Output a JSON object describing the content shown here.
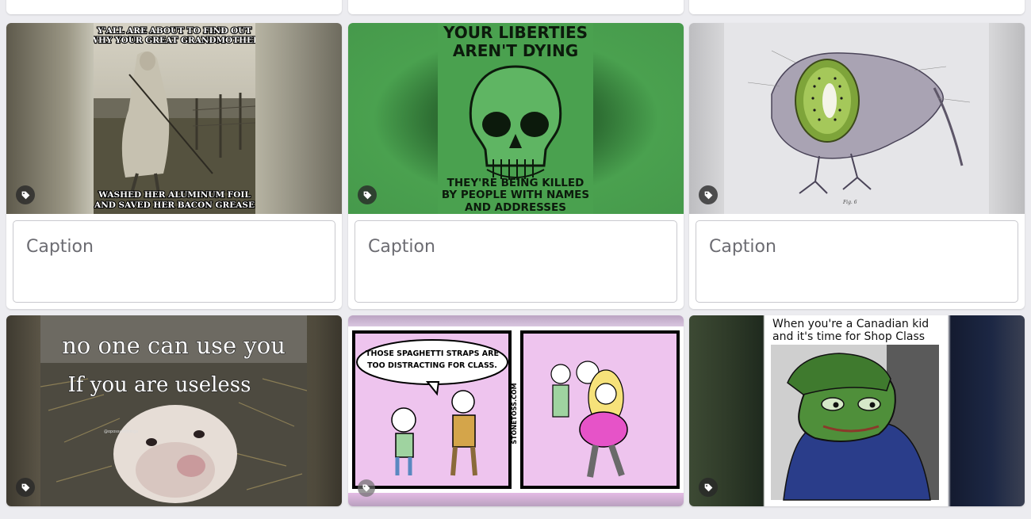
{
  "caption_placeholder": "Caption",
  "cards": [
    {
      "id": "grandmother",
      "top_text_1": "Y'ALL ARE ABOUT TO FIND OUT",
      "top_text_2": "WHY YOUR GREAT GRANDMOTHER",
      "bottom_text_1": "WASHED HER ALUMINUM FOIL",
      "bottom_text_2": "AND SAVED HER BACON GREASE"
    },
    {
      "id": "liberties",
      "top_text_1": "YOUR LIBERTIES",
      "top_text_2": "AREN'T DYING",
      "bottom_text_1": "THEY'RE BEING KILLED",
      "bottom_text_2": "BY PEOPLE WITH NAMES",
      "bottom_text_3": "AND ADDRESSES"
    },
    {
      "id": "kiwi",
      "figure_label": "Fig. 6"
    },
    {
      "id": "possum",
      "line_1": "no one can use you",
      "line_2": "If you are useless",
      "watermark": "@opossumthings"
    },
    {
      "id": "comic",
      "speech_1": "THOSE SPAGHETTI STRAPS ARE",
      "speech_2": "TOO DISTRACTING FOR CLASS.",
      "side_credit": "STONETOSS.COM"
    },
    {
      "id": "pepe",
      "caption_1": "When you're a Canadian kid",
      "caption_2": "and it's time for Shop Class"
    }
  ],
  "colors": {
    "page_bg": "#ececf0",
    "liberties_green": "#4aa14f",
    "liberties_bg": "#3f9644",
    "comic_pink": "#e9bfe9",
    "caption_border": "#c9c9ce"
  },
  "icons": {
    "tag": "tag-icon"
  }
}
